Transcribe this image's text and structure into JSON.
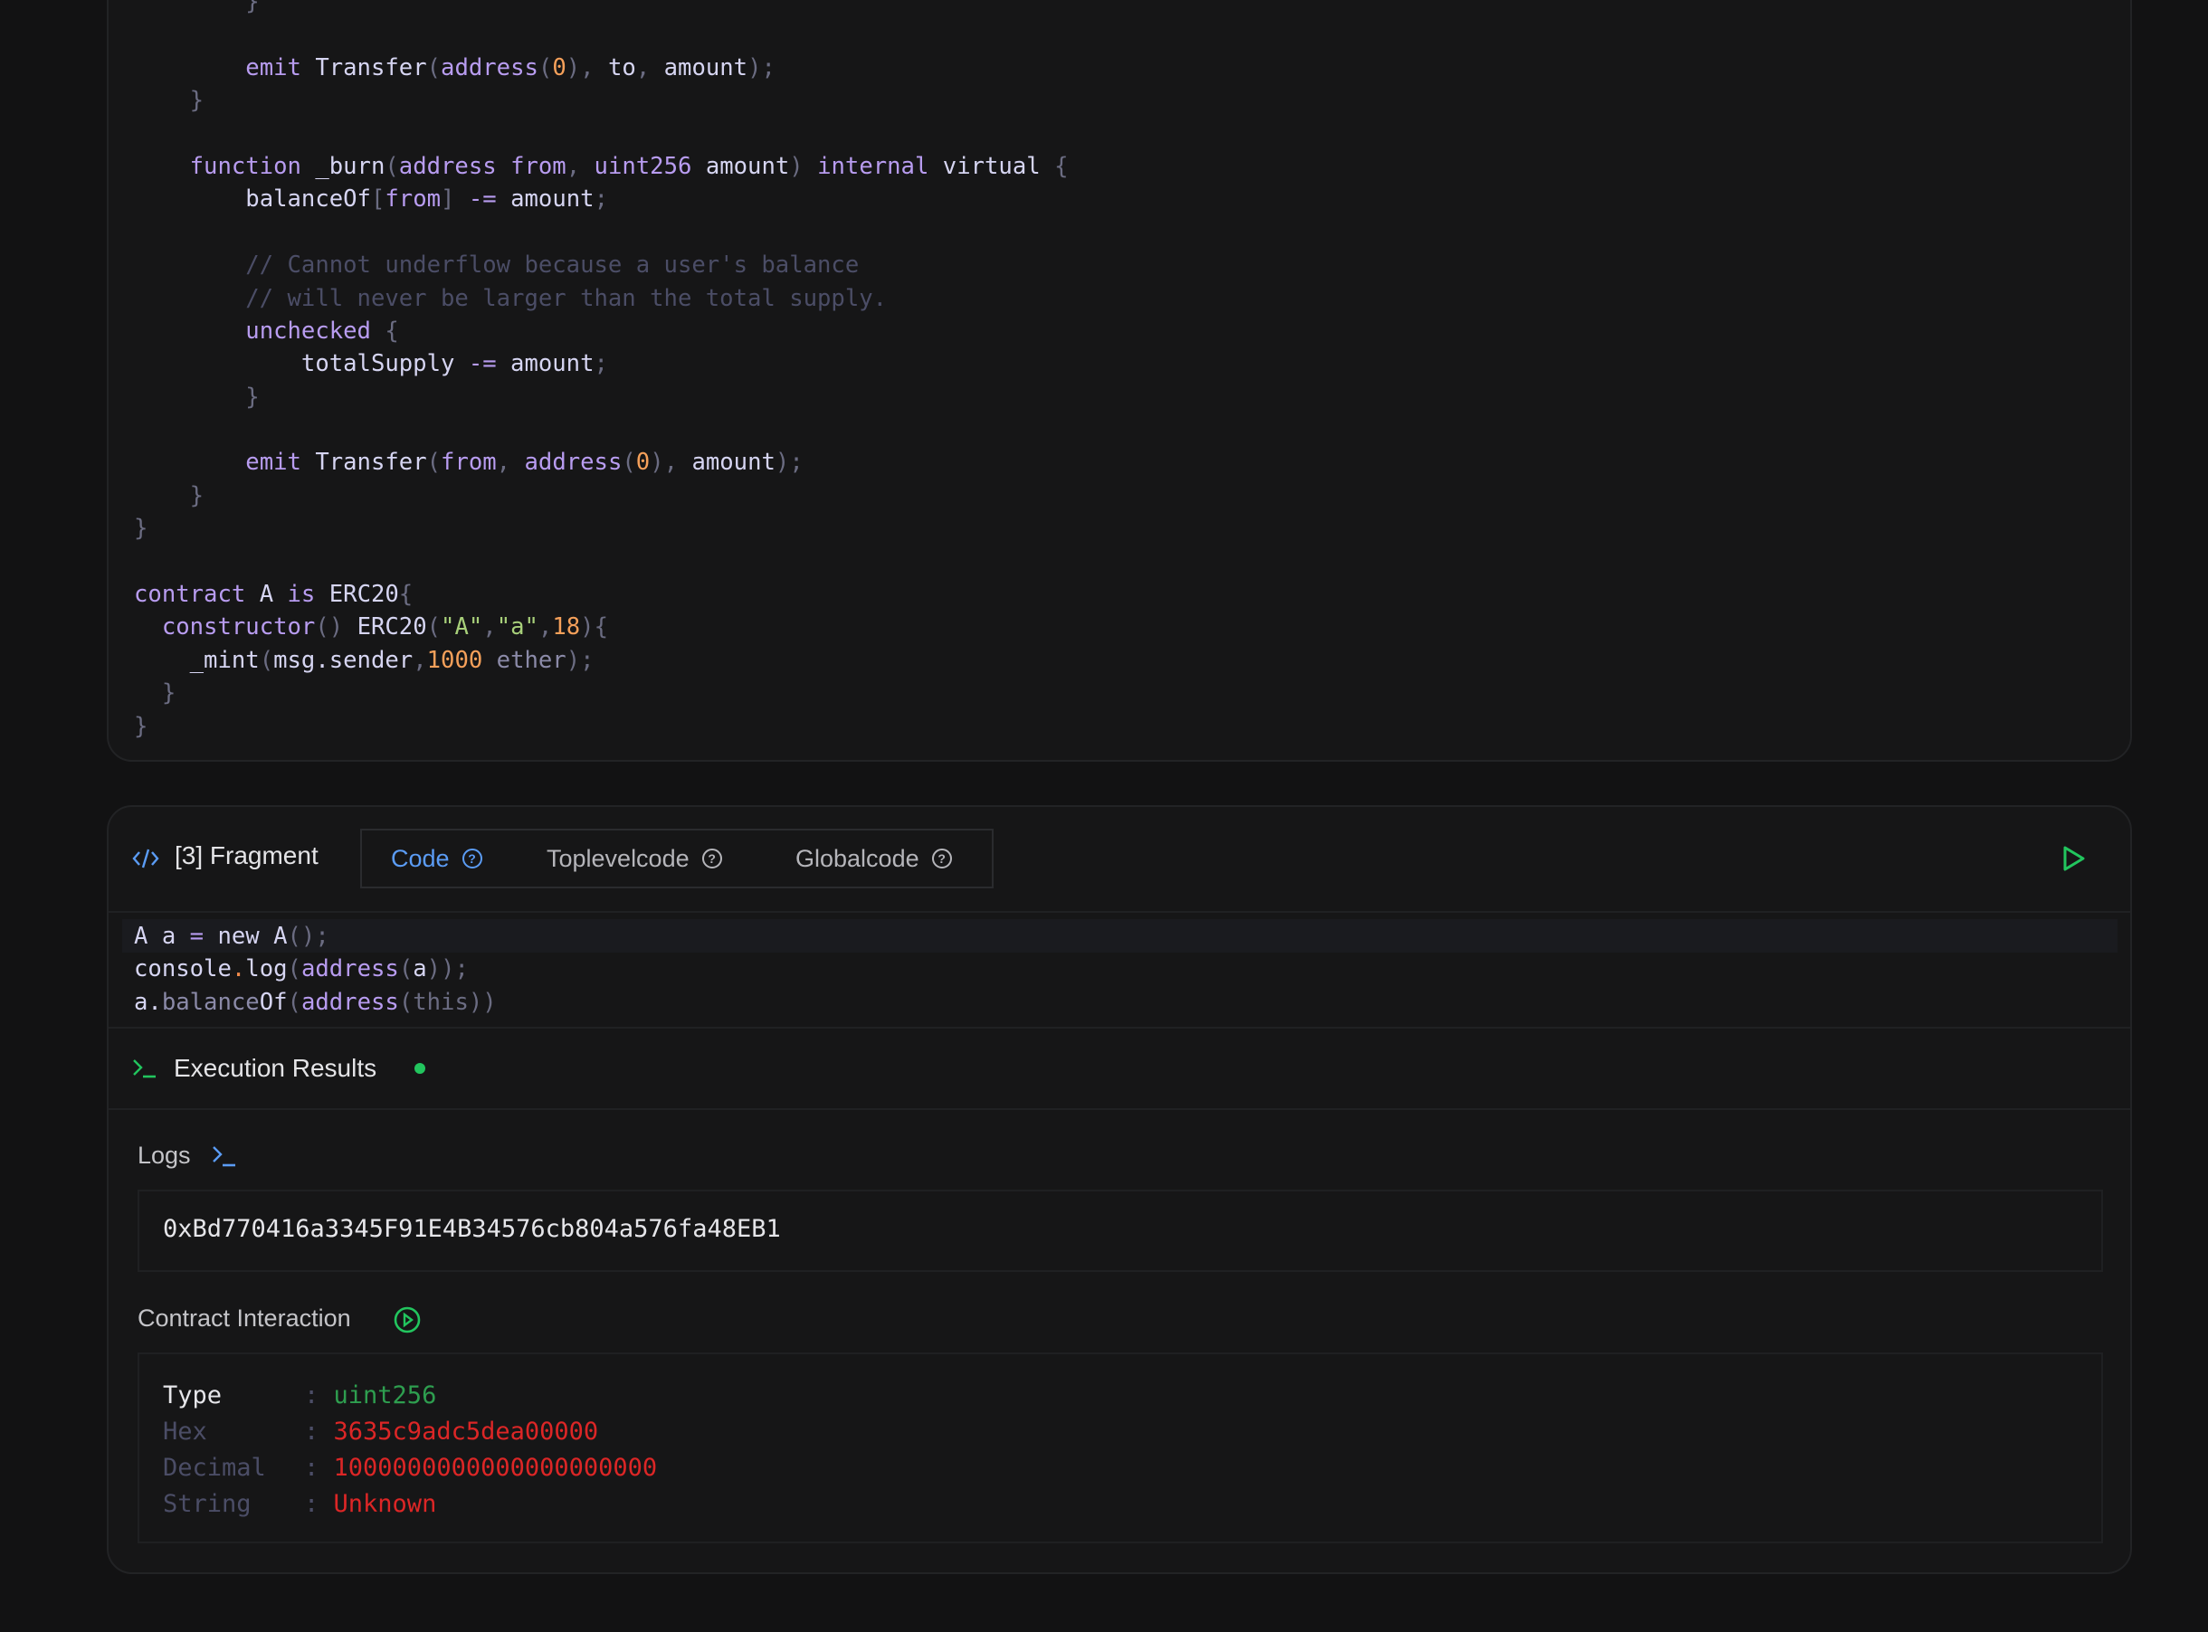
{
  "source_code": [
    [
      [
        "        ",
        "pn"
      ],
      [
        "}",
        "pn"
      ]
    ],
    [],
    [
      [
        "        ",
        "pn"
      ],
      [
        "emit",
        "kw"
      ],
      [
        " Transfer",
        "id"
      ],
      [
        "(",
        "pn"
      ],
      [
        "address",
        "kw"
      ],
      [
        "(",
        "pn"
      ],
      [
        "0",
        "nm"
      ],
      [
        "), ",
        "pn"
      ],
      [
        "to",
        "id"
      ],
      [
        ", ",
        "pn"
      ],
      [
        "amount",
        "id"
      ],
      [
        ");",
        "pn"
      ]
    ],
    [
      [
        "    }",
        "pn"
      ]
    ],
    [],
    [
      [
        "    ",
        "pn"
      ],
      [
        "function",
        "kw"
      ],
      [
        " _burn",
        "id"
      ],
      [
        "(",
        "pn"
      ],
      [
        "address from",
        "kw"
      ],
      [
        ", ",
        "pn"
      ],
      [
        "uint256",
        "kw"
      ],
      [
        " amount",
        "id"
      ],
      [
        ") ",
        "pn"
      ],
      [
        "internal",
        "kw"
      ],
      [
        " virtual",
        "id"
      ],
      [
        " {",
        "pn"
      ]
    ],
    [
      [
        "        ",
        "pn"
      ],
      [
        "balanceOf",
        "id"
      ],
      [
        "[",
        "pn"
      ],
      [
        "from",
        "kw"
      ],
      [
        "] ",
        "pn"
      ],
      [
        "-=",
        "kw"
      ],
      [
        " amount",
        "id"
      ],
      [
        ";",
        "pn"
      ]
    ],
    [],
    [
      [
        "        // Cannot underflow because a user's balance",
        "cm"
      ]
    ],
    [
      [
        "        // will never be larger than the total supply.",
        "cm"
      ]
    ],
    [
      [
        "        ",
        "pn"
      ],
      [
        "unchecked",
        "kw"
      ],
      [
        " {",
        "pn"
      ]
    ],
    [
      [
        "            ",
        "pn"
      ],
      [
        "totalSupply",
        "id"
      ],
      [
        " -=",
        "kw"
      ],
      [
        " amount",
        "id"
      ],
      [
        ";",
        "pn"
      ]
    ],
    [
      [
        "        }",
        "pn"
      ]
    ],
    [],
    [
      [
        "        ",
        "pn"
      ],
      [
        "emit",
        "kw"
      ],
      [
        " Transfer",
        "id"
      ],
      [
        "(",
        "pn"
      ],
      [
        "from",
        "kw"
      ],
      [
        ", ",
        "pn"
      ],
      [
        "address",
        "kw"
      ],
      [
        "(",
        "pn"
      ],
      [
        "0",
        "nm"
      ],
      [
        "), ",
        "pn"
      ],
      [
        "amount",
        "id"
      ],
      [
        ");",
        "pn"
      ]
    ],
    [
      [
        "    }",
        "pn"
      ]
    ],
    [
      [
        "}",
        "pn"
      ]
    ],
    [],
    [
      [
        "contract",
        "kw"
      ],
      [
        " A ",
        "id"
      ],
      [
        "is",
        "kw"
      ],
      [
        " ERC20",
        "id"
      ],
      [
        "{",
        "pn"
      ]
    ],
    [
      [
        "  ",
        "pn"
      ],
      [
        "constructor",
        "kw"
      ],
      [
        "() ",
        "pn"
      ],
      [
        "ERC20",
        "id"
      ],
      [
        "(",
        "pn"
      ],
      [
        "\"A\"",
        "st"
      ],
      [
        ",",
        "pn"
      ],
      [
        "\"a\"",
        "st"
      ],
      [
        ",",
        "pn"
      ],
      [
        "18",
        "nm"
      ],
      [
        "){",
        "pn"
      ]
    ],
    [
      [
        "    ",
        "pn"
      ],
      [
        "_mint",
        "id"
      ],
      [
        "(",
        "pn"
      ],
      [
        "msg.sender",
        "id"
      ],
      [
        ",",
        "pn"
      ],
      [
        "1000",
        "nm"
      ],
      [
        " ether",
        "mu"
      ],
      [
        ");",
        "pn"
      ]
    ],
    [
      [
        "  }",
        "pn"
      ]
    ],
    [
      [
        "}",
        "pn"
      ]
    ]
  ],
  "fragment": {
    "title": "[3] Fragment",
    "icon": "code-icon",
    "tabs": [
      {
        "label": "Code",
        "active": true
      },
      {
        "label": "Toplevelcode",
        "active": false
      },
      {
        "label": "Globalcode",
        "active": false
      }
    ],
    "run_icon": "play-icon",
    "code": [
      [
        [
          "A a ",
          "id"
        ],
        [
          "=",
          "kw"
        ],
        [
          " new A",
          "id"
        ],
        [
          "();",
          "pn"
        ]
      ],
      [
        [
          "console",
          "id"
        ],
        [
          ".",
          "or"
        ],
        [
          "log",
          "id"
        ],
        [
          "(",
          "pn"
        ],
        [
          "address",
          "kw"
        ],
        [
          "(",
          "pn"
        ],
        [
          "a",
          "id"
        ],
        [
          "));",
          "pn"
        ]
      ],
      [
        [
          "a.",
          "id"
        ],
        [
          "balance",
          "mu"
        ],
        [
          "Of",
          "id"
        ],
        [
          "(",
          "pn"
        ],
        [
          "address",
          "kw"
        ],
        [
          "(this))",
          "pn"
        ]
      ]
    ]
  },
  "results": {
    "title": "Execution Results",
    "status_color": "#22c55e",
    "logs_label": "Logs",
    "log_value": "0xBd770416a3345F91E4B34576cb804a576fa48EB1",
    "contract_label": "Contract Interaction",
    "rows": [
      {
        "key": "Type",
        "value": "uint256"
      },
      {
        "key": "Hex",
        "value": "3635c9adc5dea00000"
      },
      {
        "key": "Decimal",
        "value": "1000000000000000000000"
      },
      {
        "key": "String",
        "value": "Unknown"
      }
    ],
    "colors": {
      "accent_blue": "#5b9cf5",
      "green": "#22c55e",
      "type_green": "#2e9e4f",
      "error_red": "#dc2626"
    }
  }
}
